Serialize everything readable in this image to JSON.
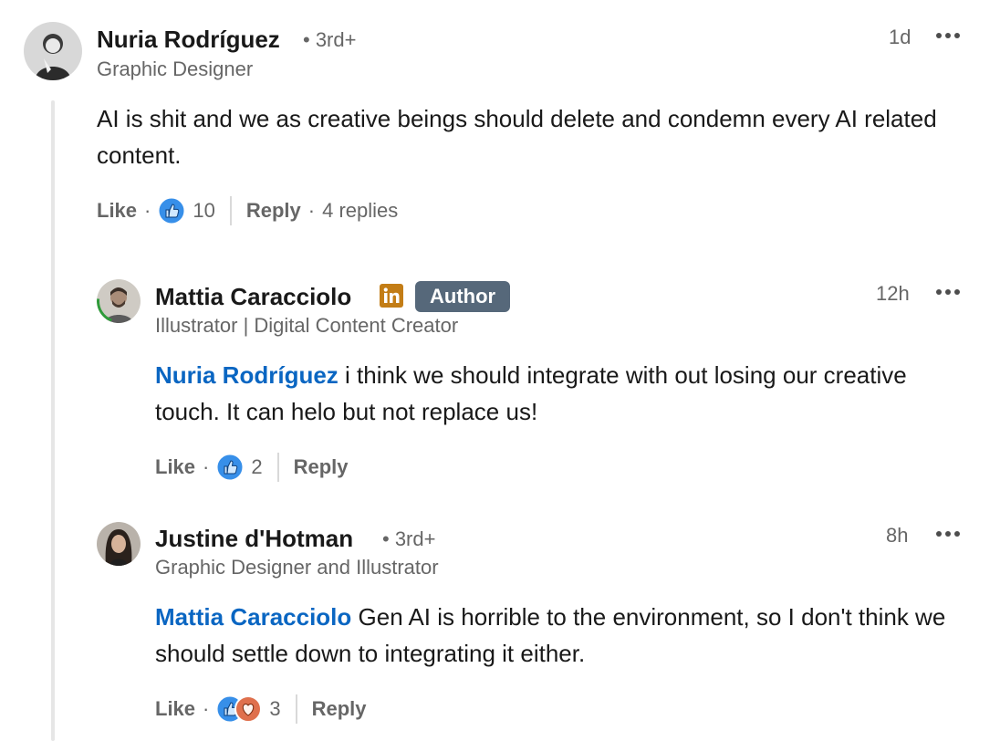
{
  "comment1": {
    "author": "Nuria Rodríguez",
    "degree": "• 3rd+",
    "headline": "Graphic Designer",
    "time": "1d",
    "text": "AI is shit and we as creative beings should delete and condemn every AI related content.",
    "like_label": "Like",
    "reaction_count": "10",
    "reply_label": "Reply",
    "replies_count": "4 replies"
  },
  "reply1": {
    "author": "Mattia Caracciolo",
    "badge": "Author",
    "headline": "Illustrator | Digital Content Creator",
    "time": "12h",
    "mention": "Nuria Rodríguez",
    "text": " i think we should integrate with out losing our creative touch. It can helo but not replace us!",
    "like_label": "Like",
    "reaction_count": "2",
    "reply_label": "Reply"
  },
  "reply2": {
    "author": "Justine d'Hotman",
    "degree": "• 3rd+",
    "headline": "Graphic Designer and Illustrator",
    "time": "8h",
    "mention": "Mattia Caracciolo",
    "text": " Gen AI is horrible to the environment, so I don't think we should settle down to integrating it either.",
    "like_label": "Like",
    "reaction_count": "3",
    "reply_label": "Reply"
  },
  "icons": {
    "more": "more-horizontal-icon",
    "like_reaction": "thumbs-up-reaction-icon",
    "love_reaction": "heart-reaction-icon",
    "linkedin_badge": "linkedin-icon"
  },
  "colors": {
    "link_blue": "#0a66c2",
    "author_badge_bg": "#56687a",
    "linkedin_gold": "#c37d16",
    "love_red": "#df704d"
  }
}
